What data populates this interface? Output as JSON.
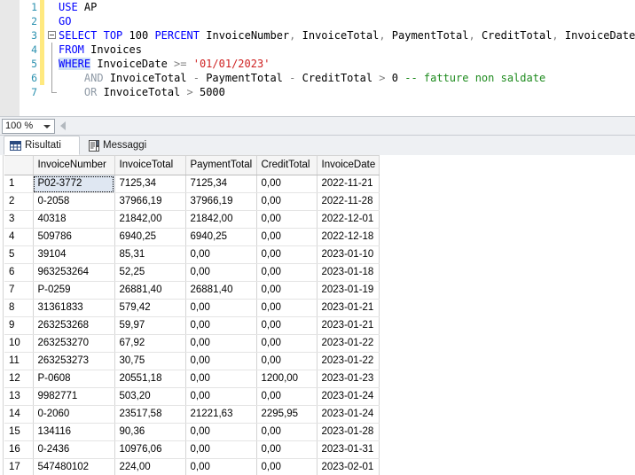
{
  "editor": {
    "zoom_level": "100 %",
    "lines": [
      {
        "number": "1",
        "changed": true,
        "fold": "none",
        "tokens": [
          {
            "t": "USE",
            "c": "k"
          },
          {
            "t": " ",
            "c": "id"
          },
          {
            "t": "AP",
            "c": "id"
          }
        ]
      },
      {
        "number": "2",
        "changed": true,
        "fold": "none",
        "tokens": [
          {
            "t": "GO",
            "c": "k"
          }
        ]
      },
      {
        "number": "3",
        "changed": true,
        "fold": "start",
        "tokens": [
          {
            "t": "SELECT",
            "c": "k"
          },
          {
            "t": " ",
            "c": "id"
          },
          {
            "t": "TOP",
            "c": "k"
          },
          {
            "t": " ",
            "c": "id"
          },
          {
            "t": "100",
            "c": "num"
          },
          {
            "t": " ",
            "c": "id"
          },
          {
            "t": "PERCENT",
            "c": "k"
          },
          {
            "t": " InvoiceNumber",
            "c": "id"
          },
          {
            "t": ",",
            "c": "op"
          },
          {
            "t": " InvoiceTotal",
            "c": "id"
          },
          {
            "t": ",",
            "c": "op"
          },
          {
            "t": " PaymentTotal",
            "c": "id"
          },
          {
            "t": ",",
            "c": "op"
          },
          {
            "t": " CreditTotal",
            "c": "id"
          },
          {
            "t": ",",
            "c": "op"
          },
          {
            "t": " InvoiceDate",
            "c": "id"
          }
        ]
      },
      {
        "number": "4",
        "changed": true,
        "fold": "mid",
        "tokens": [
          {
            "t": "FROM",
            "c": "k"
          },
          {
            "t": " Invoices",
            "c": "id"
          }
        ]
      },
      {
        "number": "5",
        "changed": true,
        "fold": "mid",
        "tokens": [
          {
            "t": "WHERE",
            "c": "k hl"
          },
          {
            "t": " InvoiceDate ",
            "c": "id"
          },
          {
            "t": ">=",
            "c": "op"
          },
          {
            "t": " ",
            "c": "id"
          },
          {
            "t": "'01/01/2023'",
            "c": "str"
          }
        ]
      },
      {
        "number": "6",
        "changed": true,
        "fold": "mid",
        "tokens": [
          {
            "t": "    ",
            "c": "id"
          },
          {
            "t": "AND",
            "c": "k2"
          },
          {
            "t": " InvoiceTotal ",
            "c": "id"
          },
          {
            "t": "-",
            "c": "op"
          },
          {
            "t": " PaymentTotal ",
            "c": "id"
          },
          {
            "t": "-",
            "c": "op"
          },
          {
            "t": " CreditTotal ",
            "c": "id"
          },
          {
            "t": ">",
            "c": "op"
          },
          {
            "t": " ",
            "c": "id"
          },
          {
            "t": "0",
            "c": "num"
          },
          {
            "t": " ",
            "c": "id"
          },
          {
            "t": "-- fatture non saldate",
            "c": "cm"
          }
        ]
      },
      {
        "number": "7",
        "changed": false,
        "fold": "end",
        "tokens": [
          {
            "t": "    ",
            "c": "id"
          },
          {
            "t": "OR",
            "c": "k2"
          },
          {
            "t": " InvoiceTotal ",
            "c": "id"
          },
          {
            "t": ">",
            "c": "op"
          },
          {
            "t": " ",
            "c": "id"
          },
          {
            "t": "5000",
            "c": "num"
          }
        ]
      }
    ]
  },
  "tabs": [
    {
      "label": "Risultati",
      "icon": "grid-icon",
      "active": true
    },
    {
      "label": "Messaggi",
      "icon": "message-icon",
      "active": false
    }
  ],
  "results": {
    "rownum_header": "",
    "columns": [
      "InvoiceNumber",
      "InvoiceTotal",
      "PaymentTotal",
      "CreditTotal",
      "InvoiceDate"
    ],
    "selected_cell": {
      "row": 1,
      "column": "InvoiceNumber"
    },
    "rows": [
      {
        "n": "1",
        "InvoiceNumber": "P02-3772",
        "InvoiceTotal": "7125,34",
        "PaymentTotal": "7125,34",
        "CreditTotal": "0,00",
        "InvoiceDate": "2022-11-21"
      },
      {
        "n": "2",
        "InvoiceNumber": "0-2058",
        "InvoiceTotal": "37966,19",
        "PaymentTotal": "37966,19",
        "CreditTotal": "0,00",
        "InvoiceDate": "2022-11-28"
      },
      {
        "n": "3",
        "InvoiceNumber": "40318",
        "InvoiceTotal": "21842,00",
        "PaymentTotal": "21842,00",
        "CreditTotal": "0,00",
        "InvoiceDate": "2022-12-01"
      },
      {
        "n": "4",
        "InvoiceNumber": "509786",
        "InvoiceTotal": "6940,25",
        "PaymentTotal": "6940,25",
        "CreditTotal": "0,00",
        "InvoiceDate": "2022-12-18"
      },
      {
        "n": "5",
        "InvoiceNumber": "39104",
        "InvoiceTotal": "85,31",
        "PaymentTotal": "0,00",
        "CreditTotal": "0,00",
        "InvoiceDate": "2023-01-10"
      },
      {
        "n": "6",
        "InvoiceNumber": "963253264",
        "InvoiceTotal": "52,25",
        "PaymentTotal": "0,00",
        "CreditTotal": "0,00",
        "InvoiceDate": "2023-01-18"
      },
      {
        "n": "7",
        "InvoiceNumber": "P-0259",
        "InvoiceTotal": "26881,40",
        "PaymentTotal": "26881,40",
        "CreditTotal": "0,00",
        "InvoiceDate": "2023-01-19"
      },
      {
        "n": "8",
        "InvoiceNumber": "31361833",
        "InvoiceTotal": "579,42",
        "PaymentTotal": "0,00",
        "CreditTotal": "0,00",
        "InvoiceDate": "2023-01-21"
      },
      {
        "n": "9",
        "InvoiceNumber": "263253268",
        "InvoiceTotal": "59,97",
        "PaymentTotal": "0,00",
        "CreditTotal": "0,00",
        "InvoiceDate": "2023-01-21"
      },
      {
        "n": "10",
        "InvoiceNumber": "263253270",
        "InvoiceTotal": "67,92",
        "PaymentTotal": "0,00",
        "CreditTotal": "0,00",
        "InvoiceDate": "2023-01-22"
      },
      {
        "n": "11",
        "InvoiceNumber": "263253273",
        "InvoiceTotal": "30,75",
        "PaymentTotal": "0,00",
        "CreditTotal": "0,00",
        "InvoiceDate": "2023-01-22"
      },
      {
        "n": "12",
        "InvoiceNumber": "P-0608",
        "InvoiceTotal": "20551,18",
        "PaymentTotal": "0,00",
        "CreditTotal": "1200,00",
        "InvoiceDate": "2023-01-23"
      },
      {
        "n": "13",
        "InvoiceNumber": "9982771",
        "InvoiceTotal": "503,20",
        "PaymentTotal": "0,00",
        "CreditTotal": "0,00",
        "InvoiceDate": "2023-01-24"
      },
      {
        "n": "14",
        "InvoiceNumber": "0-2060",
        "InvoiceTotal": "23517,58",
        "PaymentTotal": "21221,63",
        "CreditTotal": "2295,95",
        "InvoiceDate": "2023-01-24"
      },
      {
        "n": "15",
        "InvoiceNumber": "134116",
        "InvoiceTotal": "90,36",
        "PaymentTotal": "0,00",
        "CreditTotal": "0,00",
        "InvoiceDate": "2023-01-28"
      },
      {
        "n": "16",
        "InvoiceNumber": "0-2436",
        "InvoiceTotal": "10976,06",
        "PaymentTotal": "0,00",
        "CreditTotal": "0,00",
        "InvoiceDate": "2023-01-31"
      },
      {
        "n": "17",
        "InvoiceNumber": "547480102",
        "InvoiceTotal": "224,00",
        "PaymentTotal": "0,00",
        "CreditTotal": "0,00",
        "InvoiceDate": "2023-02-01"
      }
    ]
  },
  "colors": {
    "keyword": "#0000ff",
    "string": "#ce2020",
    "comment": "#1e8b1e",
    "linenumber": "#2b91af",
    "changebar": "#ffe97f",
    "selection": "#dfe7f2"
  }
}
